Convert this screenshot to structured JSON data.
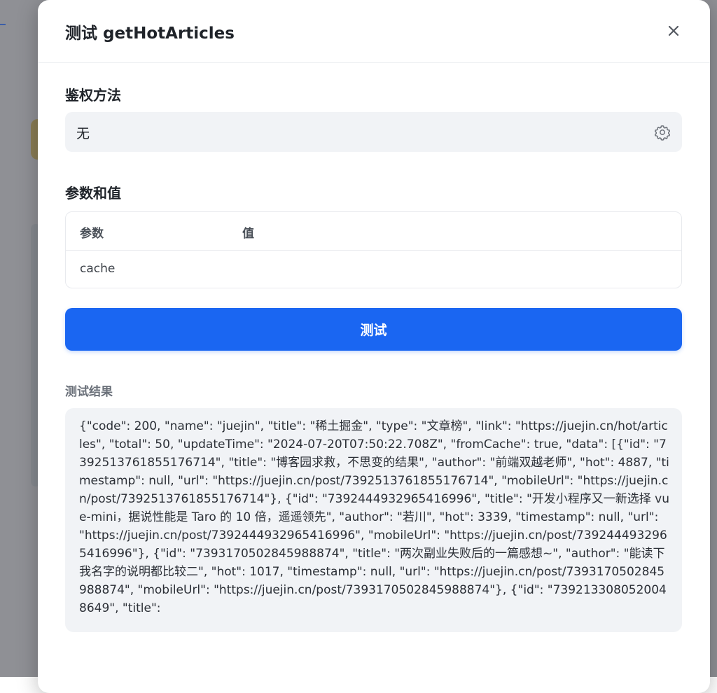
{
  "modal": {
    "title": "测试 getHotArticles"
  },
  "auth": {
    "label": "鉴权方法",
    "value": "无"
  },
  "params": {
    "label": "参数和值",
    "columns": [
      "参数",
      "值"
    ],
    "rows": [
      {
        "name": "cache",
        "value": ""
      }
    ]
  },
  "test_button": {
    "label": "测试"
  },
  "result": {
    "label": "测试结果",
    "text": "{\"code\": 200, \"name\": \"juejin\", \"title\": \"稀土掘金\", \"type\": \"文章榜\", \"link\": \"https://juejin.cn/hot/articles\", \"total\": 50, \"updateTime\": \"2024-07-20T07:50:22.708Z\", \"fromCache\": true, \"data\": [{\"id\": \"7392513761855176714\", \"title\": \"博客园求救，不思变的结果\", \"author\": \"前端双越老师\", \"hot\": 4887, \"timestamp\": null, \"url\": \"https://juejin.cn/post/7392513761855176714\", \"mobileUrl\": \"https://juejin.cn/post/7392513761855176714\"}, {\"id\": \"7392444932965416996\", \"title\": \"开发小程序又一新选择 vue-mini，据说性能是 Taro 的 10 倍，遥遥领先\", \"author\": \"若川\", \"hot\": 3339, \"timestamp\": null, \"url\": \"https://juejin.cn/post/7392444932965416996\", \"mobileUrl\": \"https://juejin.cn/post/7392444932965416996\"}, {\"id\": \"7393170502845988874\", \"title\": \"两次副业失败后的一篇感想~\", \"author\": \"能读下我名字的说明都比较二\", \"hot\": 1017, \"timestamp\": null, \"url\": \"https://juejin.cn/post/7393170502845988874\", \"mobileUrl\": \"https://juejin.cn/post/7393170502845988874\"}, {\"id\": \"7392133080520048649\", \"title\":"
  },
  "icons": {
    "close": "close-icon",
    "settings": "gear-icon"
  }
}
